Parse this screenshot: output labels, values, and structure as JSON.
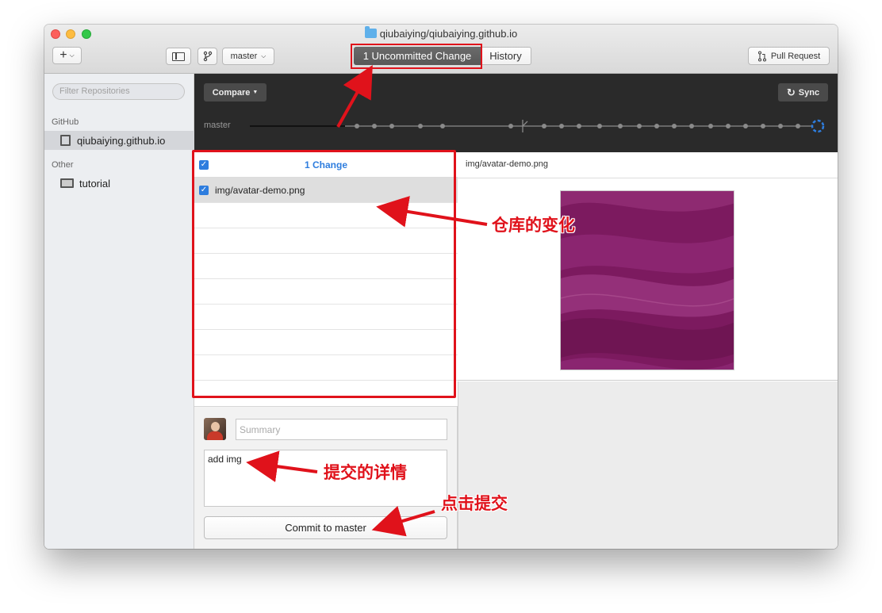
{
  "window": {
    "title": "qiubaiying/qiubaiying.github.io"
  },
  "toolbar": {
    "add_label": "+",
    "branch_label": "master",
    "uncommitted_label": "1 Uncommitted Change",
    "history_label": "History",
    "pull_request_label": "Pull Request"
  },
  "sidebar": {
    "filter_placeholder": "Filter Repositories",
    "sections": [
      {
        "title": "GitHub",
        "repos": [
          {
            "name": "qiubaiying.github.io",
            "selected": true
          }
        ]
      },
      {
        "title": "Other",
        "repos": [
          {
            "name": "tutorial",
            "selected": false
          }
        ]
      }
    ]
  },
  "graph": {
    "compare_label": "Compare",
    "sync_label": "Sync",
    "branch": "master"
  },
  "changes": {
    "title": "1 Change",
    "files": [
      {
        "path": "img/avatar-demo.png",
        "checked": true
      }
    ]
  },
  "diff": {
    "file": "img/avatar-demo.png"
  },
  "commit": {
    "summary_placeholder": "Summary",
    "description": "add img",
    "button_label": "Commit to master"
  },
  "annotations": {
    "repo_changes": "仓库的变化",
    "commit_details": "提交的详情",
    "click_commit": "点击提交"
  },
  "colors": {
    "accent_blue": "#2e7dde",
    "annotation_red": "#e0121b",
    "preview_purple": "#801d63"
  }
}
